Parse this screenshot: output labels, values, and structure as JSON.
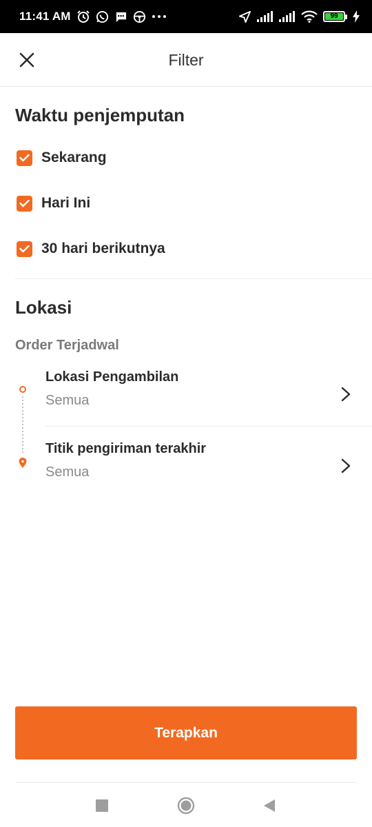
{
  "status_bar": {
    "time": "11:41 AM",
    "battery_level": "99",
    "icons_left": [
      "alarm-icon",
      "whatsapp-icon",
      "message-icon",
      "steering-wheel-icon",
      "more-dots-icon"
    ],
    "icons_right": [
      "location-arrow-icon",
      "signal-icon",
      "signal-icon",
      "wifi-icon",
      "battery-icon",
      "charging-icon"
    ]
  },
  "header": {
    "title": "Filter",
    "close_icon": "close-icon"
  },
  "pickup_time": {
    "title": "Waktu penjemputan",
    "options": [
      {
        "label": "Sekarang",
        "checked": true
      },
      {
        "label": "Hari Ini",
        "checked": true
      },
      {
        "label": "30 hari berikutnya",
        "checked": true
      }
    ]
  },
  "location": {
    "title": "Lokasi",
    "subheading": "Order Terjadwal",
    "items": [
      {
        "title": "Lokasi Pengambilan",
        "value": "Semua"
      },
      {
        "title": "Titik pengiriman terakhir",
        "value": "Semua"
      }
    ]
  },
  "apply_button": {
    "label": "Terapkan"
  },
  "colors": {
    "accent": "#f26a22",
    "text_primary": "#2b2b2b",
    "text_secondary": "#8a8a8a"
  }
}
